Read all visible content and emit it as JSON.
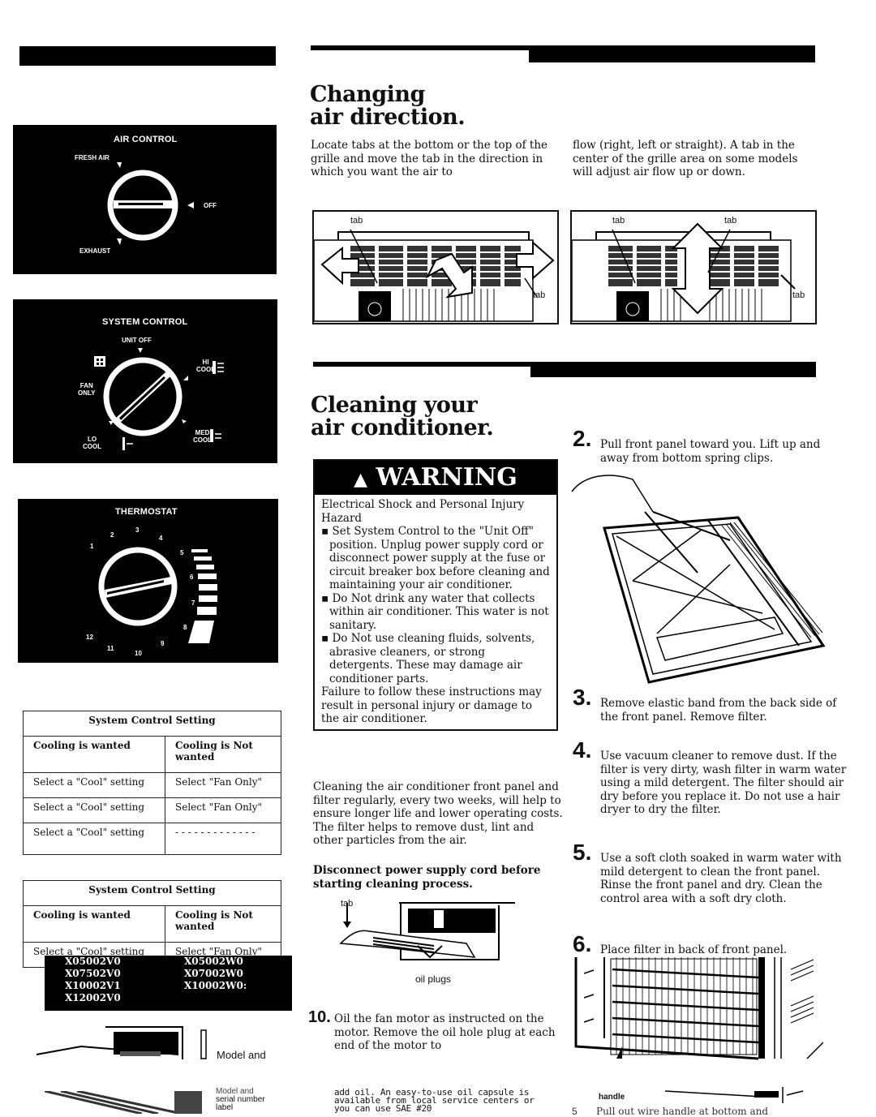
{
  "left_column": {
    "air_control": {
      "title": "AIR CONTROL",
      "labels": {
        "fresh_air": "FRESH AIR",
        "off": "OFF",
        "exhaust": "EXHAUST"
      }
    },
    "system_control": {
      "title": "SYSTEM CONTROL",
      "labels": {
        "unit_off": "UNIT OFF",
        "fan_only_1": "FAN",
        "fan_only_2": "ONLY",
        "hi_cool_1": "HI",
        "hi_cool_2": "COOL",
        "med_cool_1": "MED",
        "med_cool_2": "COOL",
        "lo_cool_1": "LO",
        "lo_cool_2": "COOL"
      }
    },
    "thermostat": {
      "title": "THERMOSTAT",
      "numbers": [
        "1",
        "2",
        "3",
        "4",
        "5",
        "6",
        "7",
        "8",
        "9",
        "10",
        "11",
        "12"
      ]
    },
    "table1": {
      "header": "System Control Setting",
      "columns": [
        "Cooling is wanted",
        "Cooling is Not wanted"
      ],
      "rows": [
        [
          "Select a \"Cool\" setting",
          "Select \"Fan Only\""
        ],
        [
          "Select a \"Cool\" setting",
          "Select \"Fan Only\""
        ],
        [
          "Select a \"Cool\" setting",
          "- - - - - - - - - - - - -"
        ]
      ]
    },
    "table2": {
      "header": "System Control Setting",
      "columns": [
        "Cooling is wanted",
        "Cooling is Not wanted"
      ],
      "partial_row": [
        "Select a \"Cool\" setting",
        "Select \"Fan Only\""
      ]
    },
    "model_box": {
      "col1": [
        "X05002V0",
        "X07502V0",
        "X10002V1",
        "X12002V0"
      ],
      "col2": [
        "X05002W0",
        "X07002W0",
        "X10002W0:"
      ]
    },
    "model_label_1": "Model and",
    "model_label_2": [
      "Model and",
      "serial number",
      "label"
    ]
  },
  "air_direction": {
    "title_line1": "Changing",
    "title_line2": "air direction.",
    "para_left": "Locate tabs at the bottom or the top of the grille and move the tab in the direction in which you want the air to",
    "para_right": "flow (right, left or straight). A tab in the center of the grille area on some models will adjust air flow up or down.",
    "fig1_labels": [
      "tab",
      "tab"
    ],
    "fig2_labels": [
      "tab",
      "tab",
      "tab"
    ]
  },
  "cleaning": {
    "title_line1": "Cleaning your",
    "title_line2": "air conditioner.",
    "warning": {
      "title": "WARNING",
      "subtitle": "Electrical Shock and Personal Injury Hazard",
      "bullets": [
        "Set System Control to the \"Unit Off\" position. Unplug power supply cord or disconnect power supply at the fuse or circuit breaker box before cleaning and maintaining your air conditioner.",
        "Do Not drink any water that collects within air conditioner. This water is not sanitary.",
        "Do Not use cleaning fluids, solvents, abrasive cleaners, or strong detergents. These may damage air conditioner parts."
      ],
      "footer": "Failure to follow these instructions may result in personal injury or damage to the air conditioner."
    },
    "intro": "Cleaning the air conditioner front panel and filter regularly, every two weeks, will help to ensure longer life and lower operating costs. The filter helps to remove dust, lint and other particles from the air.",
    "intro_bold": "Disconnect power supply cord before starting cleaning process.",
    "oil_fig_labels": {
      "tab": "tab",
      "oil_plugs": "oil plugs"
    },
    "step10": {
      "num": "10.",
      "text": "Oil the fan motor as instructed on the motor. Remove the oil hole plug at each end of the motor to"
    },
    "step10_cont": "add oil. An easy-to-use oil capsule is available from local service centers or you can use SAE #20",
    "steps": [
      {
        "num": "2.",
        "text": "Pull front panel toward you. Lift up and away from bottom spring clips."
      },
      {
        "num": "3.",
        "text": "Remove elastic band from the back side of the front panel. Remove filter."
      },
      {
        "num": "4.",
        "text": "Use vacuum cleaner to remove dust. If the filter is very dirty, wash filter in warm water using a mild detergent. The filter should air dry before you replace it. Do not use a hair dryer to dry the filter."
      },
      {
        "num": "5.",
        "text": "Use a soft cloth soaked in warm water with mild detergent to clean the front panel. Rinse the front panel and dry. Clean the control area with a soft dry cloth."
      },
      {
        "num": "6.",
        "text": "Place filter in back of front panel."
      }
    ],
    "handle_label": "handle",
    "bottom_step": {
      "num": "5",
      "text": "Pull out wire handle at bottom and"
    }
  }
}
